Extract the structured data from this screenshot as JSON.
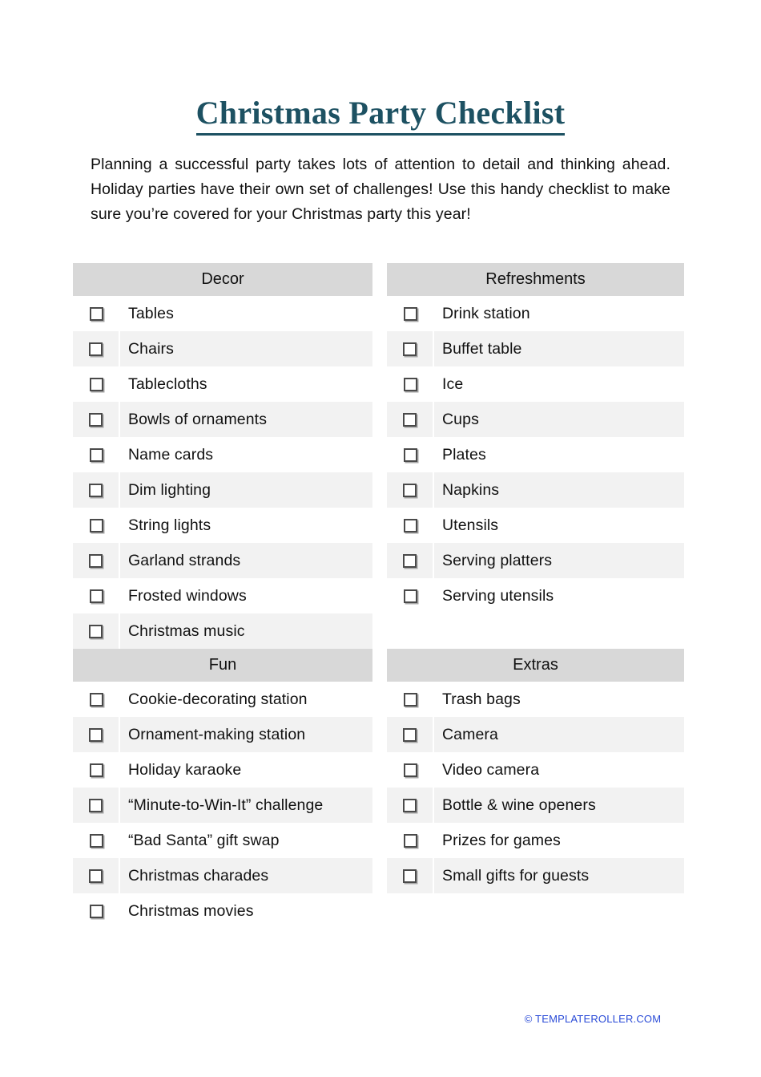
{
  "document": {
    "title": "Christmas Party Checklist",
    "intro": "Planning a successful party takes lots of attention to detail and thinking ahead. Holiday parties have their own set of challenges! Use this handy checklist to make sure you’re covered for your Christmas party this year!"
  },
  "colors": {
    "title": "#1d5162",
    "section_header_bg": "#d8d8d8",
    "row_alt_bg": "#f2f2f2",
    "row_bg": "#ffffff",
    "footer_link": "#2a4bd7",
    "checkbox_border": "#4a4a4a"
  },
  "columns": {
    "left": [
      {
        "header": "Decor",
        "items": [
          {
            "label": "Tables",
            "checked": false
          },
          {
            "label": "Chairs",
            "checked": false
          },
          {
            "label": "Tablecloths",
            "checked": false
          },
          {
            "label": "Bowls of ornaments",
            "checked": false
          },
          {
            "label": "Name cards",
            "checked": false
          },
          {
            "label": "Dim lighting",
            "checked": false
          },
          {
            "label": "String lights",
            "checked": false
          },
          {
            "label": "Garland strands",
            "checked": false
          },
          {
            "label": "Frosted windows",
            "checked": false
          },
          {
            "label": "Christmas music",
            "checked": false
          }
        ]
      },
      {
        "header": "Fun",
        "items": [
          {
            "label": "Cookie-decorating station",
            "checked": false
          },
          {
            "label": "Ornament-making station",
            "checked": false
          },
          {
            "label": "Holiday karaoke",
            "checked": false
          },
          {
            "label": "“Minute-to-Win-It” challenge",
            "checked": false
          },
          {
            "label": "“Bad Santa” gift swap",
            "checked": false
          },
          {
            "label": "Christmas charades",
            "checked": false
          },
          {
            "label": "Christmas movies",
            "checked": false
          }
        ]
      }
    ],
    "right": [
      {
        "header": "Refreshments",
        "items": [
          {
            "label": "Drink station",
            "checked": false
          },
          {
            "label": "Buffet table",
            "checked": false
          },
          {
            "label": "Ice",
            "checked": false
          },
          {
            "label": "Cups",
            "checked": false
          },
          {
            "label": "Plates",
            "checked": false
          },
          {
            "label": "Napkins",
            "checked": false
          },
          {
            "label": "Utensils",
            "checked": false
          },
          {
            "label": "Serving platters",
            "checked": false
          },
          {
            "label": "Serving utensils",
            "checked": false
          }
        ]
      },
      {
        "header": "Extras",
        "items": [
          {
            "label": "Trash bags",
            "checked": false
          },
          {
            "label": "Camera",
            "checked": false
          },
          {
            "label": "Video camera",
            "checked": false
          },
          {
            "label": "Bottle & wine openers",
            "checked": false
          },
          {
            "label": "Prizes for games",
            "checked": false
          },
          {
            "label": "Small gifts for guests",
            "checked": false
          }
        ]
      }
    ]
  },
  "footer": {
    "copyright": "© TEMPLATEROLLER.COM"
  }
}
